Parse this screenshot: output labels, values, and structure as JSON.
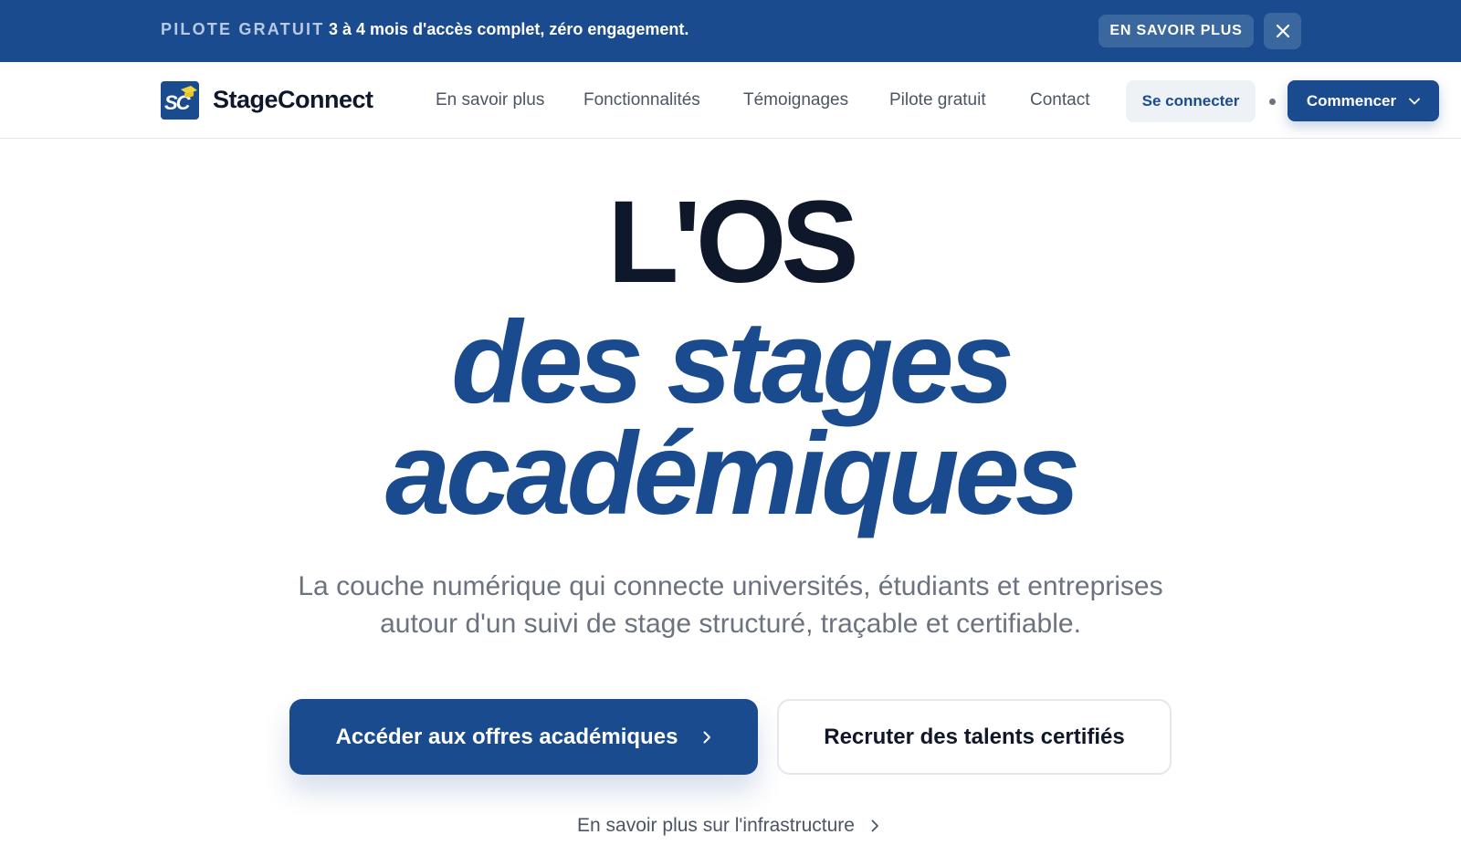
{
  "announcement": {
    "tag": "PILOTE GRATUIT",
    "message": "3 à 4 mois d'accès complet, zéro engagement.",
    "learn_more_label": "EN SAVOIR PLUS",
    "close_icon": "close-icon"
  },
  "nav": {
    "logo_mark": "SC",
    "brand": "StageConnect",
    "links": [
      {
        "label": "En savoir plus"
      },
      {
        "label": "Fonctionnalités"
      },
      {
        "label": "Témoignages"
      },
      {
        "label": "Pilote gratuit"
      },
      {
        "label": "Contact"
      }
    ],
    "login_label": "Se connecter",
    "start_label": "Commencer",
    "start_icon": "chevron-down-icon"
  },
  "hero": {
    "line1": "L'OS",
    "line2": "des stages",
    "line3": "académiques",
    "subtitle_line1": "La couche numérique qui connecte universités, étudiants et entreprises",
    "subtitle_line2": "autour d'un suivi de stage structuré, traçable et certifiable.",
    "primary_cta": "Accéder aux offres académiques",
    "secondary_cta": "Recruter des talents certifiés",
    "more_link": "En savoir plus sur l'infrastructure"
  },
  "colors": {
    "brand_blue": "#1b4b8f",
    "announce_button": "#3b679f",
    "text_dark": "#0f172a",
    "text_muted": "#6b7280",
    "logo_cap": "#f2d33c"
  }
}
